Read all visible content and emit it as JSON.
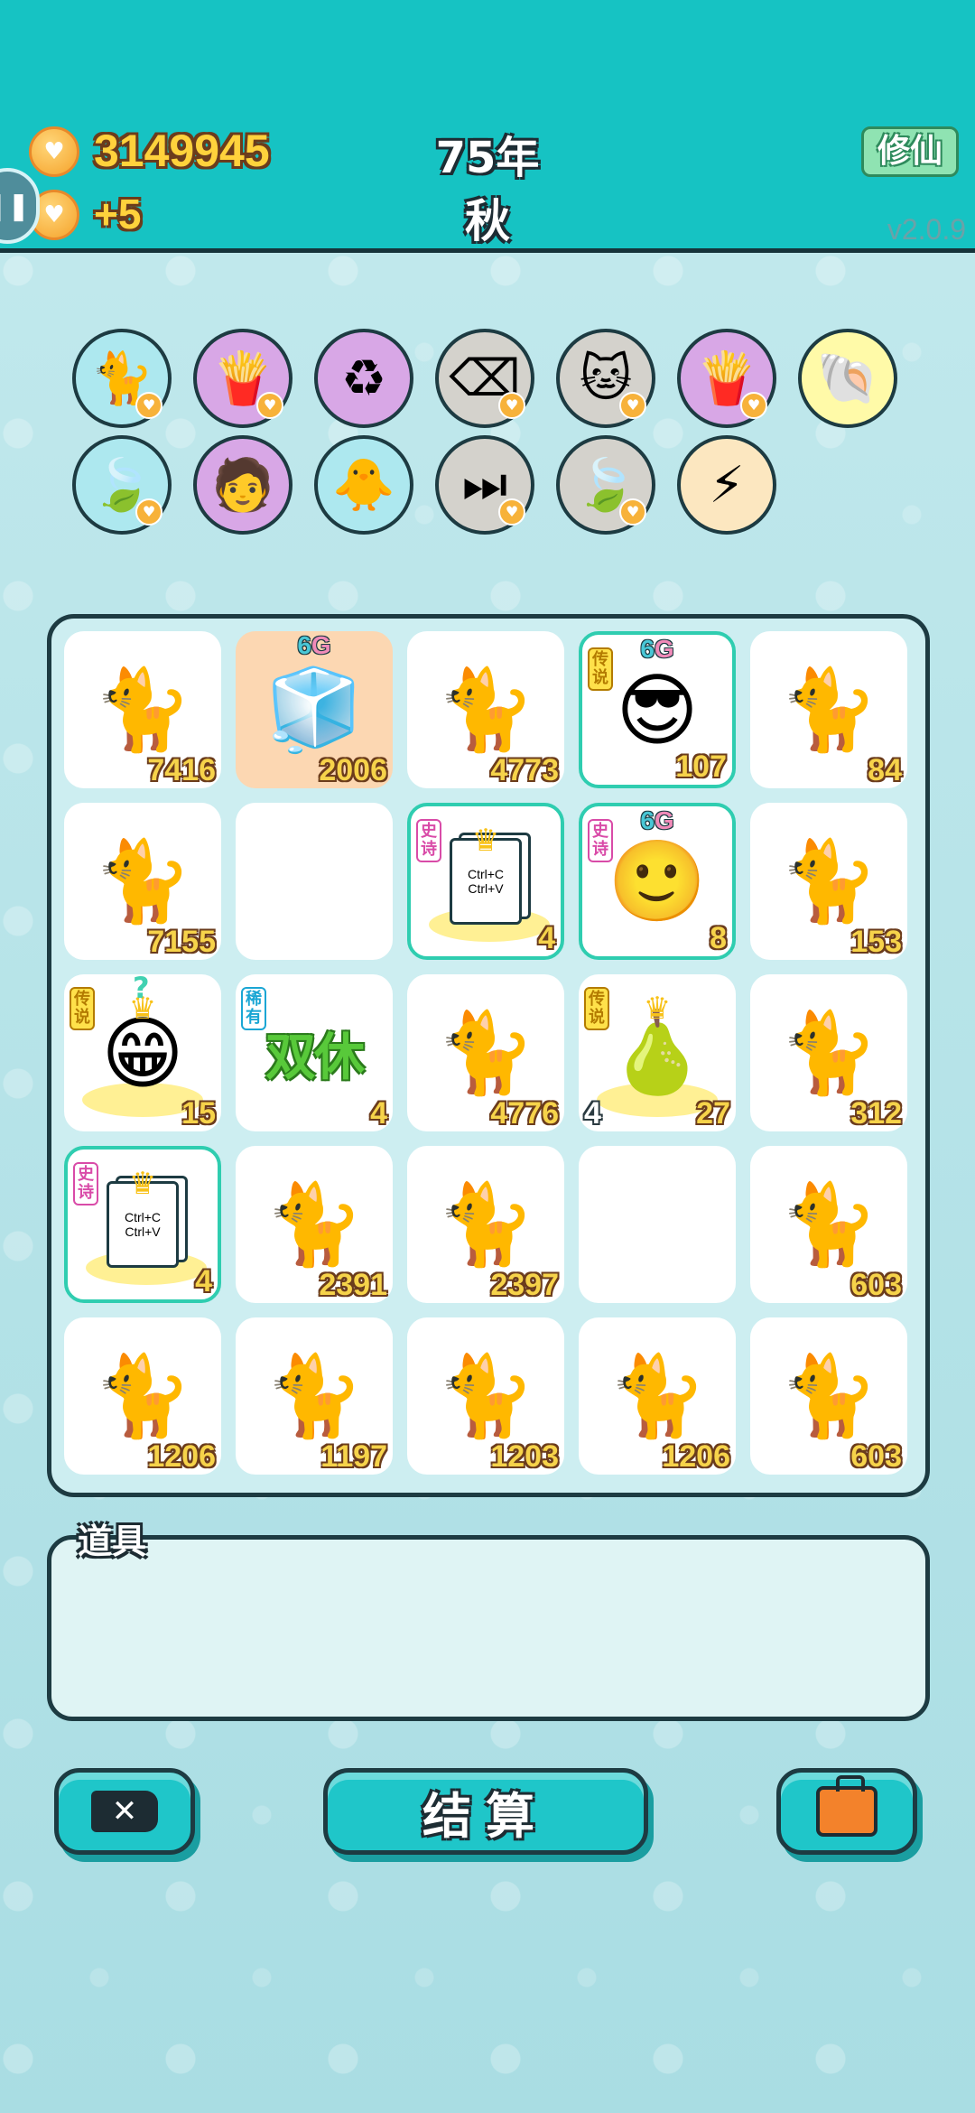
{
  "header": {
    "money": "3149945",
    "income": "+5",
    "year": "75年",
    "season": "秋",
    "cultivate_button": "修仙",
    "version": "v2.0.9",
    "side_tab_icon": "pause-icon"
  },
  "symbols": [
    {
      "name": "cat-icon",
      "bg": "#ade8ef",
      "glyph": "🐈",
      "coin": true
    },
    {
      "name": "fries-icon",
      "bg": "#d8a7e6",
      "glyph": "🍟",
      "coin": true
    },
    {
      "name": "recycle-icon",
      "bg": "#d8a7e6",
      "glyph": "♻",
      "coin": false
    },
    {
      "name": "delete-key-icon",
      "bg": "#d4d2cc",
      "glyph": "⌫",
      "coin": true
    },
    {
      "name": "twin-cats-icon",
      "bg": "#d4d2cc",
      "glyph": "🐱",
      "coin": true
    },
    {
      "name": "fries-icon",
      "bg": "#d8a7e6",
      "glyph": "🍟",
      "coin": true
    },
    {
      "name": "shell-icon",
      "bg": "#fffaa8",
      "glyph": "🐚",
      "coin": false
    },
    {
      "name": "leaf-icon",
      "bg": "#ade8ef",
      "glyph": "🍃",
      "coin": true
    },
    {
      "name": "math-student-icon",
      "bg": "#d8a7e6",
      "glyph": "🧑",
      "coin": false
    },
    {
      "name": "chick-egg-icon",
      "bg": "#ade8ef",
      "glyph": "🐥",
      "coin": false
    },
    {
      "name": "skip-icon",
      "bg": "#d4d2cc",
      "glyph": "⏭",
      "coin": true
    },
    {
      "name": "leaf-icon",
      "bg": "#d4d2cc",
      "glyph": "🍃",
      "coin": true
    },
    {
      "name": "lightning-icon",
      "bg": "#fce7c0",
      "glyph": "⚡",
      "coin": false
    }
  ],
  "board": {
    "cells": [
      {
        "art": "🐈",
        "name": "cat-icon",
        "num": "7416"
      },
      {
        "art": "🧊",
        "name": "fridge-icon",
        "num": "2006",
        "g6": true,
        "bg": "orange"
      },
      {
        "art": "🐈",
        "name": "cat-icon",
        "num": "4773"
      },
      {
        "art": "😎",
        "name": "sunglasses-man-icon",
        "num": "107",
        "g6": true,
        "tag": "传说",
        "tagType": "legend",
        "glow": true
      },
      {
        "art": "🐈",
        "name": "cat-icon",
        "num": "84"
      },
      {
        "art": "🐈",
        "name": "cat-icon",
        "num": "7155"
      },
      {
        "art": "",
        "name": "empty-cell",
        "num": ""
      },
      {
        "art": "copy",
        "name": "copy-paste-icon",
        "num": "4",
        "tag": "史诗",
        "tagType": "epic",
        "glow": true,
        "crown": true
      },
      {
        "art": "🙂",
        "name": "red-bandana-face-icon",
        "num": "8",
        "g6": true,
        "tag": "史诗",
        "tagType": "epic",
        "glow": true
      },
      {
        "art": "🐈",
        "name": "cat-icon",
        "num": "153"
      },
      {
        "art": "😁",
        "name": "old-king-icon",
        "num": "15",
        "tag": "传说",
        "tagType": "legend",
        "crown": true,
        "q": true
      },
      {
        "art": "dbl",
        "name": "double-rest-icon",
        "num": "4",
        "tag": "稀有",
        "tagType": "rare",
        "dbl": "双休"
      },
      {
        "art": "🐈",
        "name": "cat-icon",
        "num": "4776"
      },
      {
        "art": "🍐",
        "name": "pear-icon",
        "num": "27",
        "lnum": "4",
        "tag": "传说",
        "tagType": "legend",
        "crown": true
      },
      {
        "art": "🐈",
        "name": "cat-icon",
        "num": "312"
      },
      {
        "art": "copy",
        "name": "copy-paste-icon",
        "num": "4",
        "tag": "史诗",
        "tagType": "epic",
        "glow": true,
        "crown": true
      },
      {
        "art": "🐈",
        "name": "cat-icon",
        "num": "2391"
      },
      {
        "art": "🐈",
        "name": "cat-icon",
        "num": "2397"
      },
      {
        "art": "",
        "name": "empty-cell",
        "num": ""
      },
      {
        "art": "🐈",
        "name": "cat-icon",
        "num": "603"
      },
      {
        "art": "🐈",
        "name": "cat-icon",
        "num": "1206"
      },
      {
        "art": "🐈",
        "name": "cat-icon",
        "num": "1197"
      },
      {
        "art": "🐈",
        "name": "cat-icon",
        "num": "1203"
      },
      {
        "art": "🐈",
        "name": "cat-icon",
        "num": "1206"
      },
      {
        "art": "🐈",
        "name": "cat-icon",
        "num": "603"
      }
    ],
    "g6_label": "6",
    "g6_suffix": "G",
    "copy_line1": "Ctrl+C",
    "copy_line2": "Ctrl+V",
    "q_mark": "?"
  },
  "items": {
    "label": "道具"
  },
  "buttons": {
    "remove_icon": "delete-icon",
    "settle_label": "结算",
    "bag_icon": "briefcase-icon"
  },
  "colors": {
    "topbar": "#16c3c3",
    "accent": "#1fc6c9",
    "coin_text": "#ffd23c",
    "outline": "#1d3b42"
  }
}
